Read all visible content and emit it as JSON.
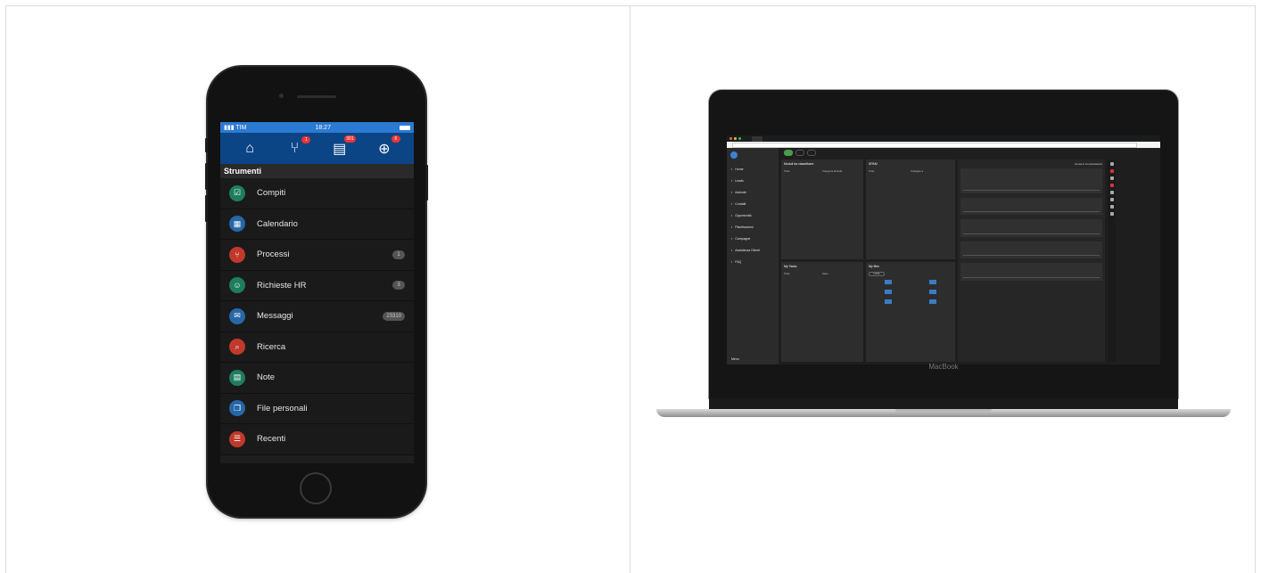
{
  "phone": {
    "status": {
      "carrier": "TIM",
      "time": "18:27"
    },
    "nav_badges": {
      "processes": "1",
      "messages": "301",
      "web": "6"
    },
    "section_title": "Strumenti",
    "menu": [
      {
        "label": "Compiti",
        "count": "",
        "color": "#1e7d5f",
        "icon": "checklist-icon"
      },
      {
        "label": "Calendario",
        "count": "",
        "color": "#2667a8",
        "icon": "calendar-icon"
      },
      {
        "label": "Processi",
        "count": "1",
        "color": "#c0392b",
        "icon": "process-icon"
      },
      {
        "label": "Richieste HR",
        "count": "3",
        "color": "#1e7d5f",
        "icon": "hr-icon"
      },
      {
        "label": "Messaggi",
        "count": "23310",
        "color": "#2667a8",
        "icon": "mail-icon"
      },
      {
        "label": "Ricerca",
        "count": "",
        "color": "#c0392b",
        "icon": "search-icon"
      },
      {
        "label": "Note",
        "count": "",
        "color": "#1e7d5f",
        "icon": "note-icon"
      },
      {
        "label": "File personali",
        "count": "",
        "color": "#2667a8",
        "icon": "files-icon"
      },
      {
        "label": "Recenti",
        "count": "",
        "color": "#c0392b",
        "icon": "list-icon"
      }
    ]
  },
  "laptop": {
    "brand": "MacBook",
    "sidebar": [
      "Home",
      "Leads",
      "Aziende",
      "Contatti",
      "Opportunità",
      "Pianificazioni",
      "Campagne",
      "Assistenza Clienti",
      "FAQ"
    ],
    "sidebar_menu": "Menu",
    "cards": {
      "c1_title": "Moduli da classificare",
      "c1_cols": [
        "Titolo",
        "Categoria Modello"
      ],
      "c2_title": "My Tasks",
      "c2_cols": [
        "Titolo",
        "Stato"
      ],
      "c3_title": "SPAM",
      "c3_cols": [
        "Titolo",
        "Collegato a"
      ],
      "c4_title": "My files",
      "c4_button": "LISTA"
    },
    "feed_header": "Cerca in Conversazioni"
  }
}
